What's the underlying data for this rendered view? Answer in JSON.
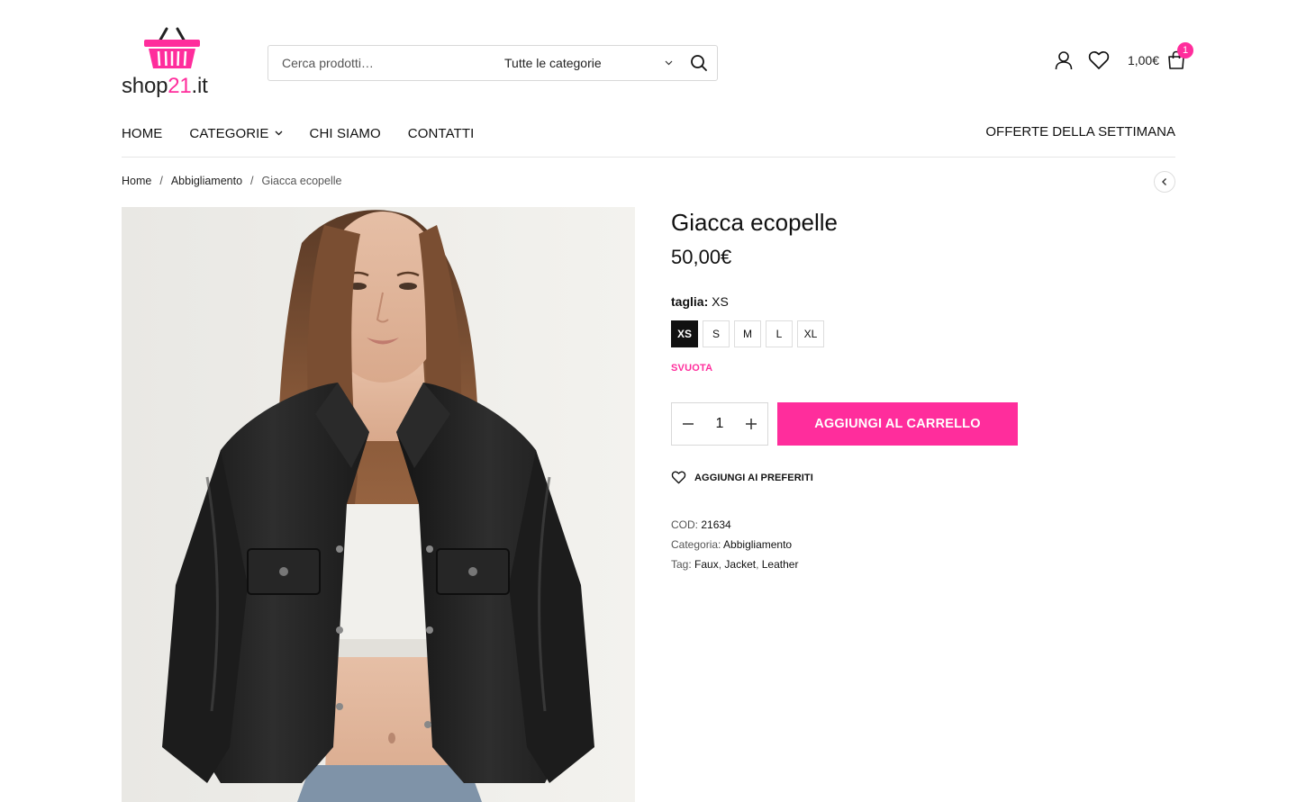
{
  "brand": {
    "logo_text_prefix": "shop",
    "logo_text_num": "21",
    "logo_text_suffix": ".it",
    "accent_color": "#ff2d9c"
  },
  "search": {
    "placeholder": "Cerca prodotti…",
    "category_label": "Tutte le categorie"
  },
  "header": {
    "cart_total": "1,00€",
    "cart_count": "1"
  },
  "nav": {
    "items": [
      {
        "label": "HOME"
      },
      {
        "label": "CATEGORIE"
      },
      {
        "label": "CHI SIAMO"
      },
      {
        "label": "CONTATTI"
      }
    ],
    "right_label": "OFFERTE DELLA SETTIMANA"
  },
  "breadcrumb": {
    "items": [
      "Home",
      "Abbigliamento"
    ],
    "current": "Giacca ecopelle"
  },
  "product": {
    "title": "Giacca ecopelle",
    "price": "50,00€",
    "attribute_name": "taglia:",
    "attribute_value": "XS",
    "sizes": [
      "XS",
      "S",
      "M",
      "L",
      "XL"
    ],
    "selected_size": "XS",
    "clear_label": "SVUOTA",
    "quantity": "1",
    "add_to_cart_label": "AGGIUNGI AL CARRELLO",
    "wishlist_label": "AGGIUNGI AI PREFERITI",
    "sku_label": "COD:",
    "sku": "21634",
    "category_label": "Categoria:",
    "category": "Abbigliamento",
    "tags_label": "Tag:",
    "tags": [
      "Faux",
      "Jacket",
      "Leather"
    ]
  }
}
